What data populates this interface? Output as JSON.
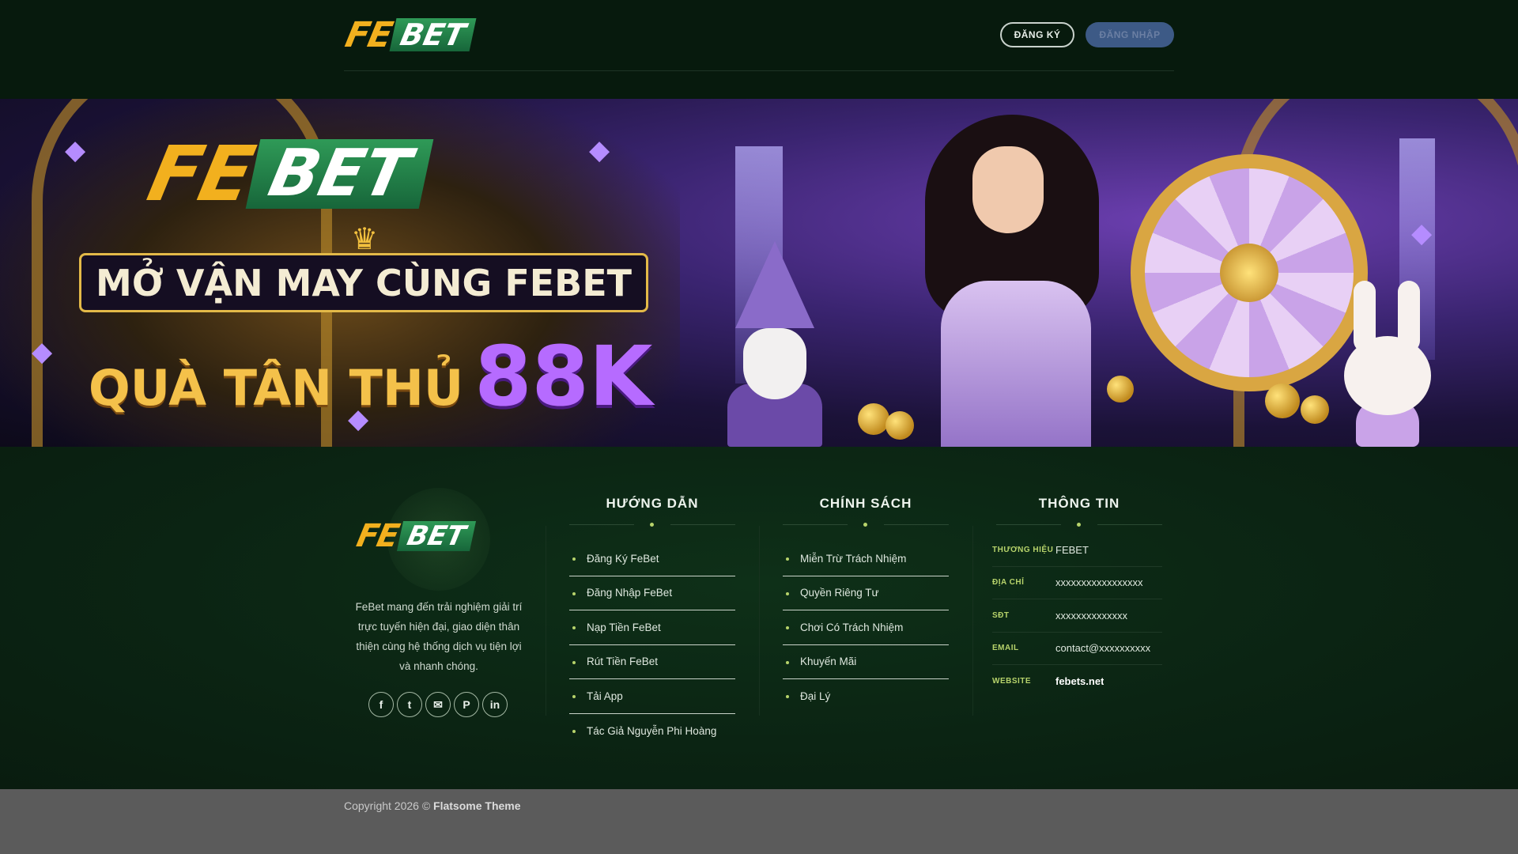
{
  "header": {
    "logo": {
      "part1": "FE",
      "part2": "BET"
    },
    "register_label": "ĐĂNG KÝ",
    "login_label": "ĐĂNG NHẬP"
  },
  "banner": {
    "logo": {
      "part1": "FE",
      "part2": "BET"
    },
    "slogan_line1": "MỞ VẬN MAY CÙNG FEBET",
    "slogan_line2": "QUÀ TÂN THỦ",
    "amount": "88K"
  },
  "footer": {
    "logo": {
      "part1": "FE",
      "part2": "BET"
    },
    "about": "FeBet mang đến trải nghiệm giải trí trực tuyến hiện đại, giao diện thân thiện cùng hệ thống dịch vụ tiện lợi và nhanh chóng.",
    "socials": [
      {
        "icon": "facebook-icon",
        "glyph": "f"
      },
      {
        "icon": "twitter-icon",
        "glyph": "t"
      },
      {
        "icon": "email-icon",
        "glyph": "✉"
      },
      {
        "icon": "pinterest-icon",
        "glyph": "P"
      },
      {
        "icon": "linkedin-icon",
        "glyph": "in"
      }
    ],
    "guide": {
      "title": "HƯỚNG DẪN",
      "items": [
        "Đăng Ký FeBet",
        "Đăng Nhập FeBet",
        "Nạp Tiền FeBet",
        "Rút Tiền FeBet",
        "Tải App",
        "Tác Giả Nguyễn Phi Hoàng"
      ]
    },
    "policy": {
      "title": "CHÍNH SÁCH",
      "items": [
        "Miễn Trừ Trách Nhiệm",
        "Quyền Riêng Tư",
        "Chơi Có Trách Nhiệm",
        "Khuyến Mãi",
        "Đại Lý"
      ]
    },
    "info": {
      "title": "THÔNG TIN",
      "rows": [
        {
          "label": "THƯƠNG HIỆU",
          "value": "FEBET"
        },
        {
          "label": "ĐỊA CHỈ",
          "value": "xxxxxxxxxxxxxxxxx"
        },
        {
          "label": "SĐT",
          "value": "xxxxxxxxxxxxxx"
        },
        {
          "label": "EMAIL",
          "value": "contact@xxxxxxxxxx"
        },
        {
          "label": "WEBSITE",
          "value": "febets.net"
        }
      ]
    }
  },
  "bottom": {
    "copyright_prefix": "Copyright 2026 ©",
    "theme_name": "Flatsome Theme"
  },
  "colors": {
    "header_bg": "#071a0d",
    "footer_bg": "#0b2413",
    "accent_dot": "#b7d36b",
    "logo_gold": "#f2b01e",
    "logo_green": "#17663a",
    "login_button": "#3d5a86",
    "bottom_bar": "#5b5b5b"
  }
}
